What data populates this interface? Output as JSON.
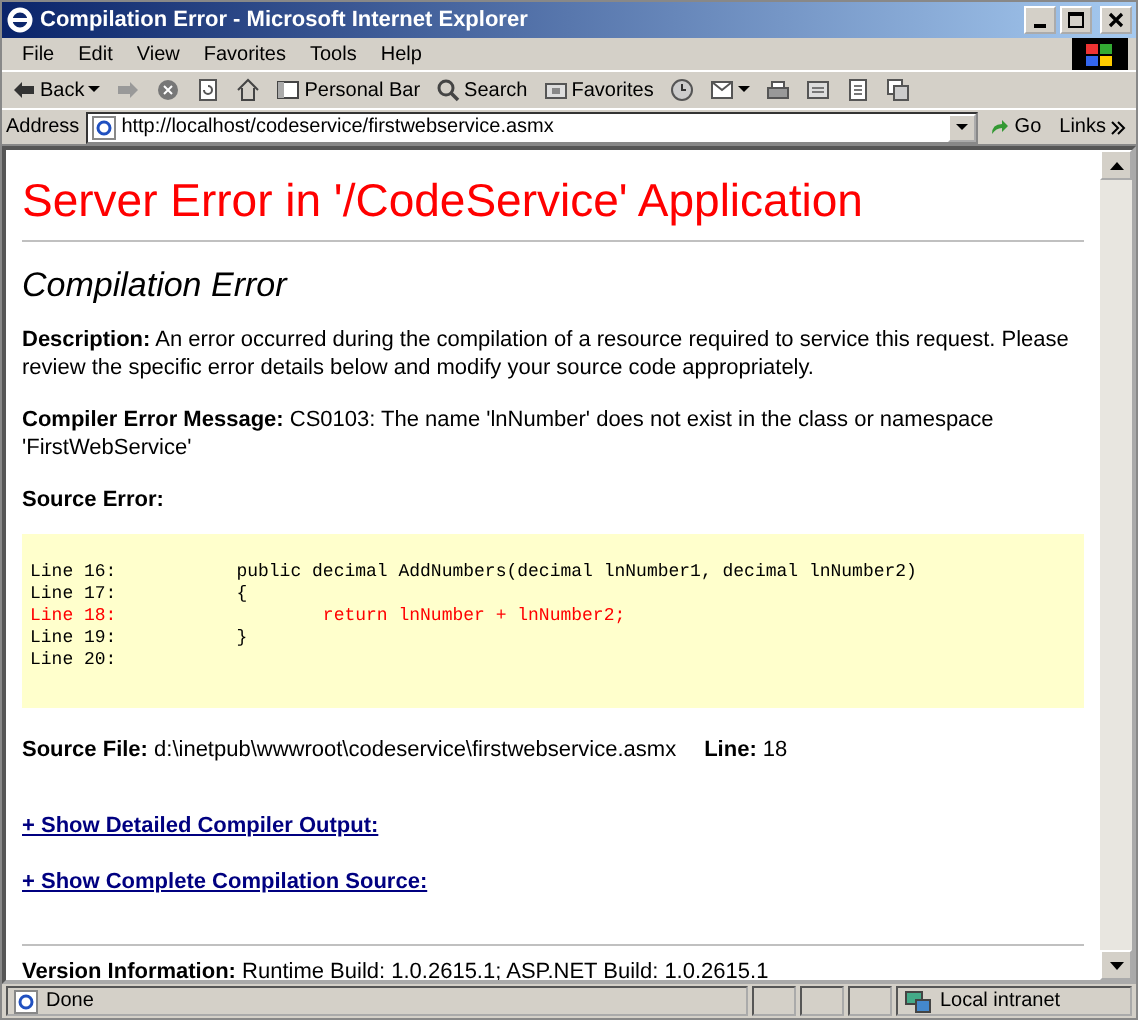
{
  "window": {
    "title": "Compilation Error - Microsoft Internet Explorer"
  },
  "menu": [
    "File",
    "Edit",
    "View",
    "Favorites",
    "Tools",
    "Help"
  ],
  "toolbar": [
    {
      "kind": "back",
      "label": "Back"
    },
    {
      "kind": "forward"
    },
    {
      "kind": "stop"
    },
    {
      "kind": "refresh"
    },
    {
      "kind": "home"
    },
    {
      "kind": "personal",
      "label": "Personal Bar"
    },
    {
      "kind": "search",
      "label": "Search"
    },
    {
      "kind": "favorites",
      "label": "Favorites"
    },
    {
      "kind": "history"
    },
    {
      "kind": "mail"
    },
    {
      "kind": "print"
    },
    {
      "kind": "edit"
    },
    {
      "kind": "discuss"
    },
    {
      "kind": "messenger"
    }
  ],
  "address": {
    "label": "Address",
    "value": "http://localhost/codeservice/firstwebservice.asmx",
    "go": "Go",
    "links": "Links"
  },
  "page": {
    "heading": "Server Error in '/CodeService' Application",
    "subheading": "Compilation Error",
    "description": {
      "label": "Description:",
      "text": "An error occurred during the compilation of a resource required to service this request. Please review the specific error details below and modify your source code appropriately."
    },
    "compiler_message": {
      "label": "Compiler Error Message:",
      "text": "CS0103: The name 'lnNumber' does not exist in the class or namespace 'FirstWebService'"
    },
    "source_error_label": "Source Error:",
    "code_lines": [
      {
        "line": "Line 16:",
        "code": "        public decimal AddNumbers(decimal lnNumber1, decimal lnNumber2)",
        "kind": "normal"
      },
      {
        "line": "Line 17:",
        "code": "        {",
        "kind": "normal"
      },
      {
        "line": "Line 18:",
        "code": "                return lnNumber + lnNumber2;",
        "kind": "error"
      },
      {
        "line": "Line 19:",
        "code": "        }",
        "kind": "normal"
      },
      {
        "line": "Line 20:",
        "kind": "normal"
      }
    ],
    "source_file": {
      "label": "Source File:",
      "value": "d:\\inetpub\\wwwroot\\codeservice\\firstwebservice.asmx",
      "line_label": "Line:",
      "line_value": "18"
    },
    "links": [
      "+ Show Detailed Compiler Output:",
      "+ Show Complete Compilation Source:"
    ],
    "version": {
      "label": "Version Information:",
      "text": "Runtime Build: 1.0.2615.1; ASP.NET Build: 1.0.2615.1"
    }
  },
  "status_bar": {
    "text": "Done",
    "zone": "Local intranet"
  }
}
